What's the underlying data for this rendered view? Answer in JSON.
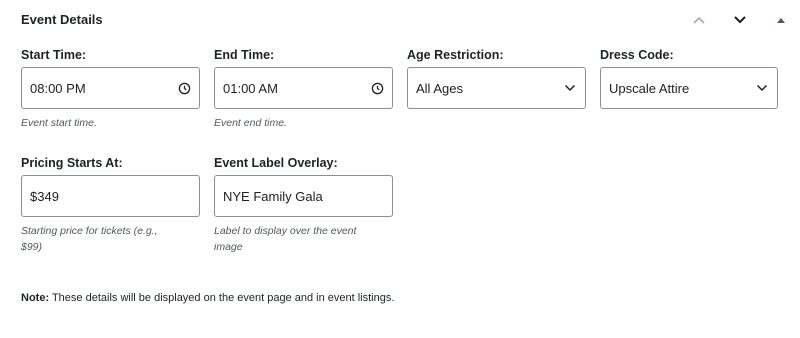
{
  "panel": {
    "title": "Event Details",
    "icons": [
      "chevron-up-icon",
      "chevron-down-icon",
      "caret-up-icon"
    ]
  },
  "fields": {
    "start_time": {
      "label": "Start Time:",
      "value": "08:00 PM",
      "help": "Event start time.",
      "icon": "clock-icon"
    },
    "end_time": {
      "label": "End Time:",
      "value": "01:00 AM",
      "help": "Event end time.",
      "icon": "clock-icon"
    },
    "age_restriction": {
      "label": "Age Restriction:",
      "value": "All Ages",
      "icon": "chevron-down-icon"
    },
    "dress_code": {
      "label": "Dress Code:",
      "value": "Upscale Attire",
      "icon": "chevron-down-icon"
    },
    "pricing": {
      "label": "Pricing Starts At:",
      "value": "$349",
      "help_line1": "Starting price for tickets (e.g.,",
      "help_line2": "$99)"
    },
    "label_overlay": {
      "label": "Event Label Overlay:",
      "value": "NYE Family Gala",
      "help_line1": "Label to display over the event",
      "help_line2": "image"
    }
  },
  "note": {
    "prefix": "Note:",
    "text": " These details will be displayed on the event page and in event listings."
  },
  "colors": {
    "border": "#8c8f94",
    "help_text": "#50575e",
    "text": "#1d2327"
  }
}
